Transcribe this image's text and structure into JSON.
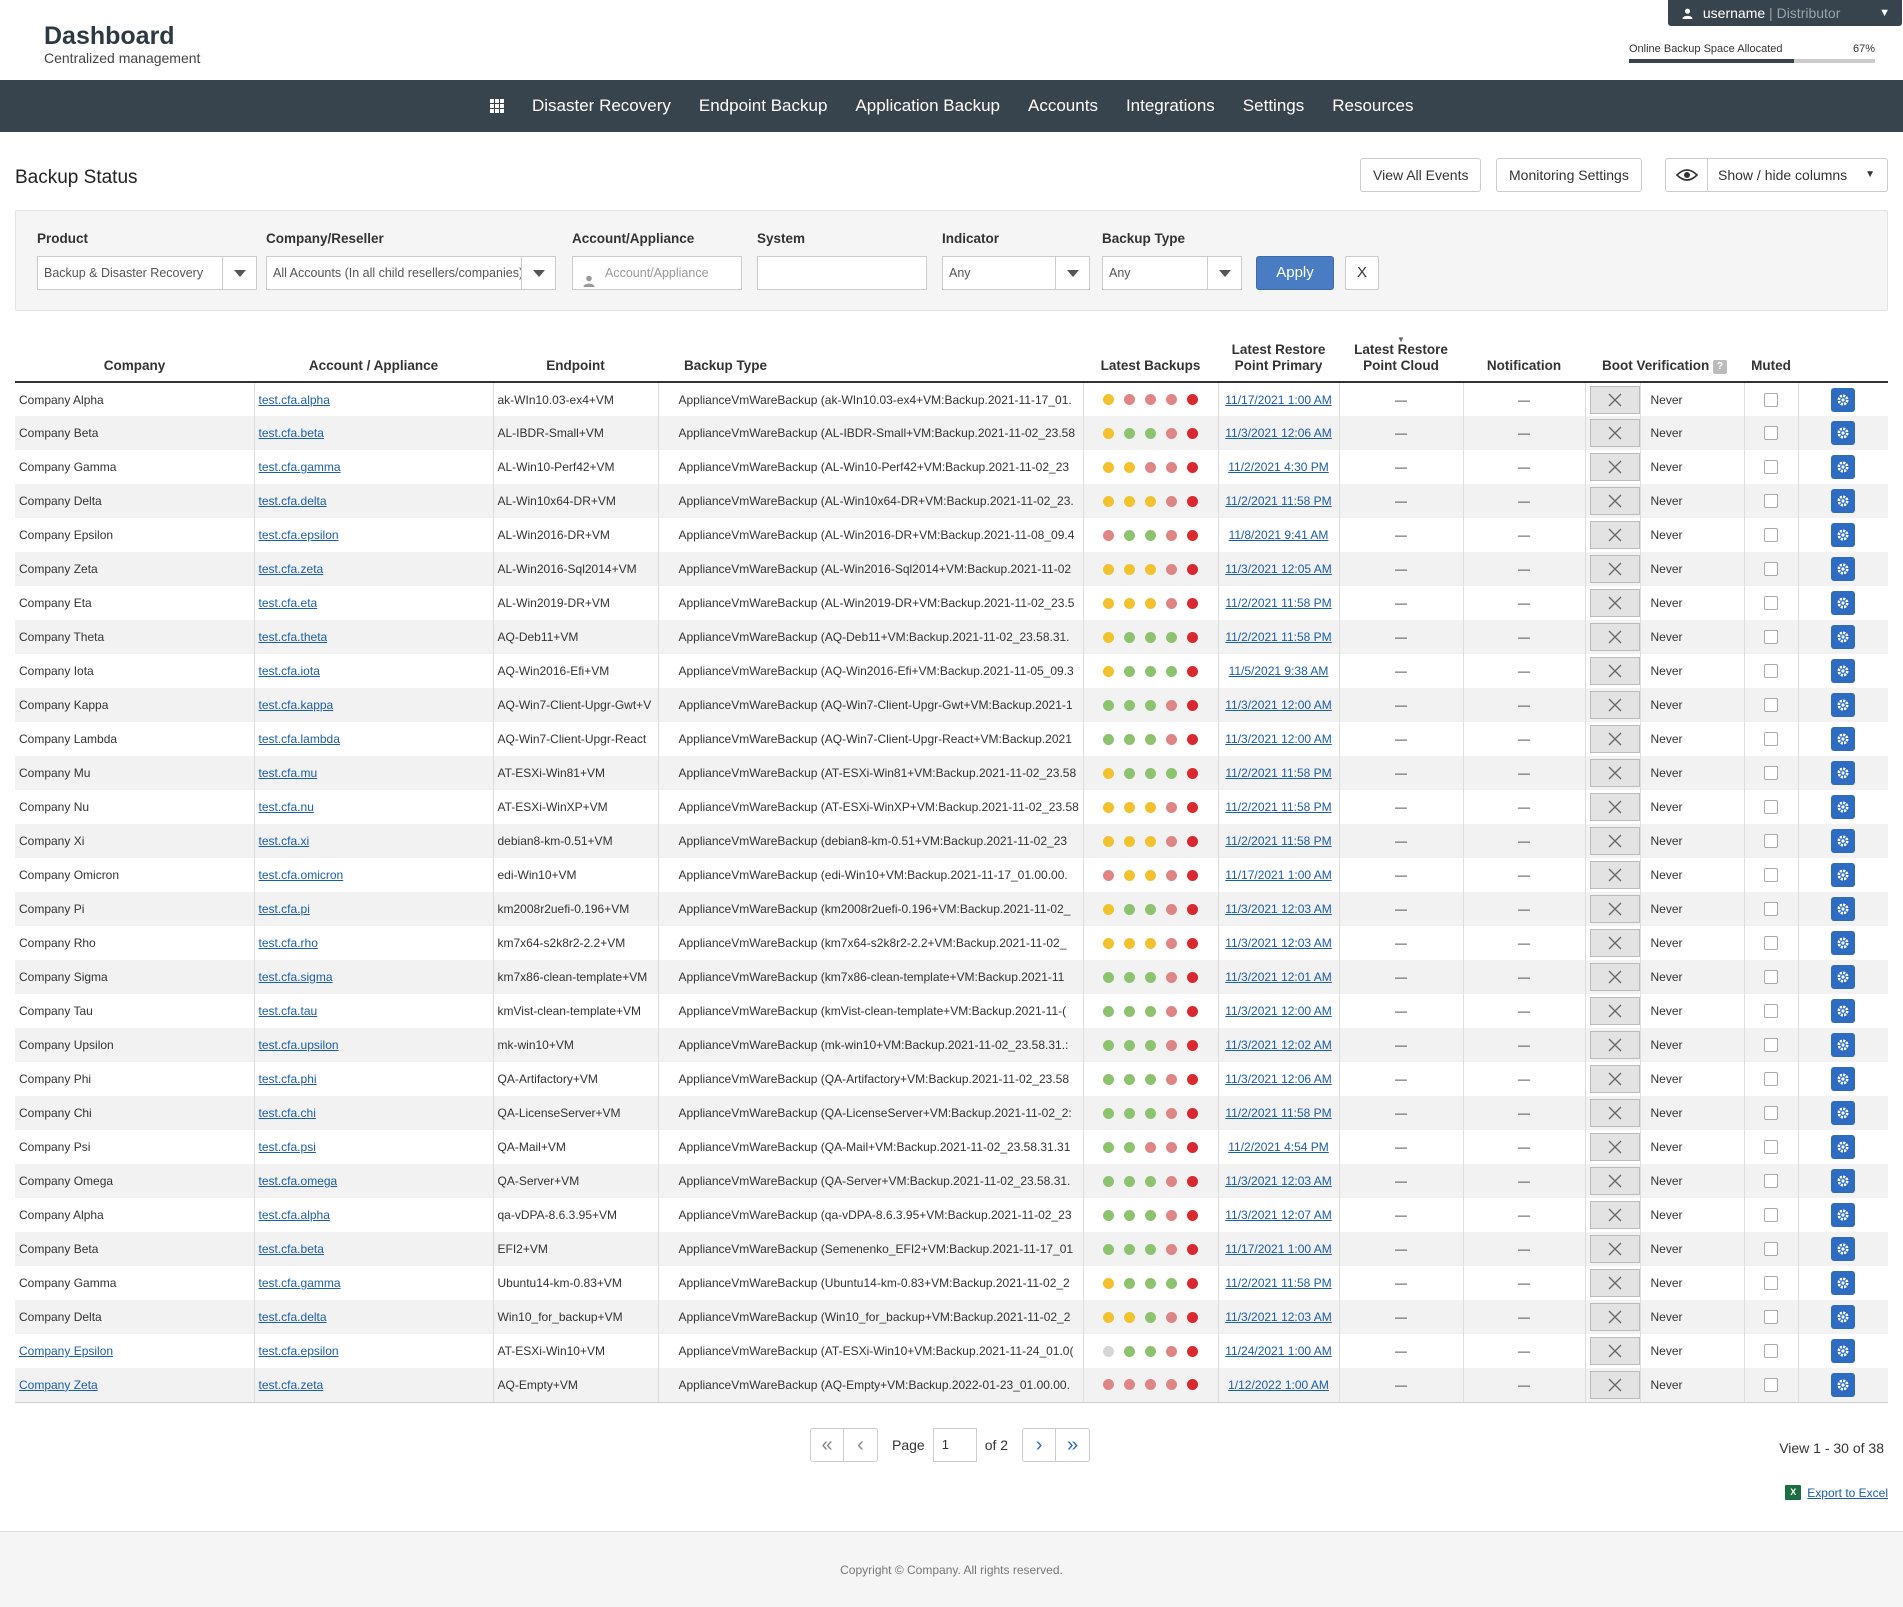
{
  "header": {
    "title": "Dashboard",
    "subtitle": "Centralized management",
    "user": {
      "name": "username",
      "role": "Distributor"
    },
    "space": {
      "label": "Online Backup Space Allocated",
      "value_text": "67%",
      "fraction": 0.67
    }
  },
  "nav": {
    "items": [
      "Disaster Recovery",
      "Endpoint Backup",
      "Application Backup",
      "Accounts",
      "Integrations",
      "Settings",
      "Resources"
    ]
  },
  "page": {
    "title": "Backup Status",
    "view_all_events": "View All Events",
    "monitoring_settings": "Monitoring Settings",
    "show_hide_columns": "Show / hide columns"
  },
  "filters": {
    "product": {
      "label": "Product",
      "value": "Backup & Disaster Recovery"
    },
    "company": {
      "label": "Company/Reseller",
      "value": "All Accounts (In all child resellers/companies)"
    },
    "account": {
      "label": "Account/Appliance",
      "placeholder": "Account/Appliance"
    },
    "system": {
      "label": "System",
      "value": ""
    },
    "indicator": {
      "label": "Indicator",
      "value": "Any"
    },
    "backup_type": {
      "label": "Backup Type",
      "value": "Any"
    },
    "apply": "Apply",
    "clear": "X"
  },
  "table": {
    "columns": {
      "company": "Company",
      "account": "Account / Appliance",
      "endpoint": "Endpoint",
      "backup_type": "Backup Type",
      "latest_backups": "Latest Backups",
      "restore_primary_1": "Latest Restore",
      "restore_primary_2": "Point Primary",
      "restore_cloud_1": "Latest Restore",
      "restore_cloud_2": "Point Cloud",
      "notification": "Notification",
      "boot_verification": "Boot Verification",
      "boot_help": "?",
      "muted": "Muted"
    },
    "dash": "—",
    "colors": {
      "y": "#f2c12e",
      "g": "#8dc26f",
      "p": "#e08585",
      "r": "#d9282f",
      "n": "#d5d5d5"
    },
    "rows": [
      {
        "company": "Company Alpha",
        "account": "test.cfa.alpha",
        "endpoint": "ak-WIn10.03-ex4+VM",
        "backup": "ApplianceVmWareBackup (ak-WIn10.03-ex4+VM:Backup.2021-11-17_01.",
        "dots": "ypppr",
        "restore": "11/17/2021 1:00 AM",
        "boot": "Never",
        "company_link": false
      },
      {
        "company": "Company Beta",
        "account": "test.cfa.beta",
        "endpoint": "AL-IBDR-Small+VM",
        "backup": "ApplianceVmWareBackup (AL-IBDR-Small+VM:Backup.2021-11-02_23.58",
        "dots": "yggpr",
        "restore": "11/3/2021 12:06 AM",
        "boot": "Never",
        "company_link": false
      },
      {
        "company": "Company Gamma",
        "account": "test.cfa.gamma",
        "endpoint": "AL-Win10-Perf42+VM",
        "backup": "ApplianceVmWareBackup (AL-Win10-Perf42+VM:Backup.2021-11-02_23",
        "dots": "yyppr",
        "restore": "11/2/2021 4:30 PM",
        "boot": "Never",
        "company_link": false
      },
      {
        "company": "Company Delta",
        "account": "test.cfa.delta",
        "endpoint": "AL-Win10x64-DR+VM",
        "backup": "ApplianceVmWareBackup (AL-Win10x64-DR+VM:Backup.2021-11-02_23.",
        "dots": "yyypr",
        "restore": "11/2/2021 11:58 PM",
        "boot": "Never",
        "company_link": false
      },
      {
        "company": "Company Epsilon",
        "account": "test.cfa.epsilon",
        "endpoint": "AL-Win2016-DR+VM",
        "backup": "ApplianceVmWareBackup (AL-Win2016-DR+VM:Backup.2021-11-08_09.4",
        "dots": "pggpr",
        "restore": "11/8/2021 9:41 AM",
        "boot": "Never",
        "company_link": false
      },
      {
        "company": "Company Zeta",
        "account": "test.cfa.zeta",
        "endpoint": "AL-Win2016-Sql2014+VM",
        "backup": "ApplianceVmWareBackup (AL-Win2016-Sql2014+VM:Backup.2021-11-02",
        "dots": "yyypr",
        "restore": "11/3/2021 12:05 AM",
        "boot": "Never",
        "company_link": false
      },
      {
        "company": "Company Eta",
        "account": "test.cfa.eta",
        "endpoint": "AL-Win2019-DR+VM",
        "backup": "ApplianceVmWareBackup (AL-Win2019-DR+VM:Backup.2021-11-02_23.5",
        "dots": "yyypr",
        "restore": "11/2/2021 11:58 PM",
        "boot": "Never",
        "company_link": false
      },
      {
        "company": "Company Theta",
        "account": "test.cfa.theta",
        "endpoint": "AQ-Deb11+VM",
        "backup": "ApplianceVmWareBackup (AQ-Deb11+VM:Backup.2021-11-02_23.58.31.",
        "dots": "ygggr",
        "restore": "11/2/2021 11:58 PM",
        "boot": "Never",
        "company_link": false
      },
      {
        "company": "Company Iota",
        "account": "test.cfa.iota",
        "endpoint": "AQ-Win2016-Efi+VM",
        "backup": "ApplianceVmWareBackup (AQ-Win2016-Efi+VM:Backup.2021-11-05_09.3",
        "dots": "ygggr",
        "restore": "11/5/2021 9:38 AM",
        "boot": "Never",
        "company_link": false
      },
      {
        "company": "Company Kappa",
        "account": "test.cfa.kappa",
        "endpoint": "AQ-Win7-Client-Upgr-Gwt+V",
        "backup": "ApplianceVmWareBackup (AQ-Win7-Client-Upgr-Gwt+VM:Backup.2021-1",
        "dots": "gggpr",
        "restore": "11/3/2021 12:00 AM",
        "boot": "Never",
        "company_link": false
      },
      {
        "company": "Company Lambda",
        "account": "test.cfa.lambda",
        "endpoint": "AQ-Win7-Client-Upgr-React",
        "backup": "ApplianceVmWareBackup (AQ-Win7-Client-Upgr-React+VM:Backup.2021",
        "dots": "gggpr",
        "restore": "11/3/2021 12:00 AM",
        "boot": "Never",
        "company_link": false
      },
      {
        "company": "Company Mu",
        "account": "test.cfa.mu",
        "endpoint": "AT-ESXi-Win81+VM",
        "backup": "ApplianceVmWareBackup (AT-ESXi-Win81+VM:Backup.2021-11-02_23.58",
        "dots": "ygggr",
        "restore": "11/2/2021 11:58 PM",
        "boot": "Never",
        "company_link": false
      },
      {
        "company": "Company Nu",
        "account": "test.cfa.nu",
        "endpoint": "AT-ESXi-WinXP+VM",
        "backup": "ApplianceVmWareBackup (AT-ESXi-WinXP+VM:Backup.2021-11-02_23.58",
        "dots": "yyypr",
        "restore": "11/2/2021 11:58 PM",
        "boot": "Never",
        "company_link": false
      },
      {
        "company": "Company Xi",
        "account": "test.cfa.xi",
        "endpoint": "debian8-km-0.51+VM",
        "backup": "ApplianceVmWareBackup (debian8-km-0.51+VM:Backup.2021-11-02_23",
        "dots": "yyypr",
        "restore": "11/2/2021 11:58 PM",
        "boot": "Never",
        "company_link": false
      },
      {
        "company": "Company Omicron",
        "account": "test.cfa.omicron",
        "endpoint": "edi-Win10+VM",
        "backup": "ApplianceVmWareBackup (edi-Win10+VM:Backup.2021-11-17_01.00.00.",
        "dots": "pyypr",
        "restore": "11/17/2021 1:00 AM",
        "boot": "Never",
        "company_link": false
      },
      {
        "company": "Company Pi",
        "account": "test.cfa.pi",
        "endpoint": "km2008r2uefi-0.196+VM",
        "backup": "ApplianceVmWareBackup (km2008r2uefi-0.196+VM:Backup.2021-11-02_",
        "dots": "yggpr",
        "restore": "11/3/2021 12:03 AM",
        "boot": "Never",
        "company_link": false
      },
      {
        "company": "Company Rho",
        "account": "test.cfa.rho",
        "endpoint": "km7x64-s2k8r2-2.2+VM",
        "backup": "ApplianceVmWareBackup (km7x64-s2k8r2-2.2+VM:Backup.2021-11-02_",
        "dots": "yyypr",
        "restore": "11/3/2021 12:03 AM",
        "boot": "Never",
        "company_link": false
      },
      {
        "company": "Company Sigma",
        "account": "test.cfa.sigma",
        "endpoint": "km7x86-clean-template+VM",
        "backup": "ApplianceVmWareBackup (km7x86-clean-template+VM:Backup.2021-11",
        "dots": "gggpr",
        "restore": "11/3/2021 12:01 AM",
        "boot": "Never",
        "company_link": false
      },
      {
        "company": "Company Tau",
        "account": "test.cfa.tau",
        "endpoint": "kmVist-clean-template+VM",
        "backup": "ApplianceVmWareBackup (kmVist-clean-template+VM:Backup.2021-11-(",
        "dots": "gggpr",
        "restore": "11/3/2021 12:00 AM",
        "boot": "Never",
        "company_link": false
      },
      {
        "company": "Company Upsilon",
        "account": "test.cfa.upsilon",
        "endpoint": "mk-win10+VM",
        "backup": "ApplianceVmWareBackup (mk-win10+VM:Backup.2021-11-02_23.58.31.:",
        "dots": "gggpr",
        "restore": "11/3/2021 12:02 AM",
        "boot": "Never",
        "company_link": false
      },
      {
        "company": "Company Phi",
        "account": "test.cfa.phi",
        "endpoint": "QA-Artifactory+VM",
        "backup": "ApplianceVmWareBackup (QA-Artifactory+VM:Backup.2021-11-02_23.58",
        "dots": "gggpr",
        "restore": "11/3/2021 12:06 AM",
        "boot": "Never",
        "company_link": false
      },
      {
        "company": "Company Chi",
        "account": "test.cfa.chi",
        "endpoint": "QA-LicenseServer+VM",
        "backup": "ApplianceVmWareBackup (QA-LicenseServer+VM:Backup.2021-11-02_2:",
        "dots": "gggpr",
        "restore": "11/2/2021 11:58 PM",
        "boot": "Never",
        "company_link": false
      },
      {
        "company": "Company Psi",
        "account": "test.cfa.psi",
        "endpoint": "QA-Mail+VM",
        "backup": "ApplianceVmWareBackup (QA-Mail+VM:Backup.2021-11-02_23.58.31.31",
        "dots": "ggppr",
        "restore": "11/2/2021 4:54 PM",
        "boot": "Never",
        "company_link": false
      },
      {
        "company": "Company Omega",
        "account": "test.cfa.omega",
        "endpoint": "QA-Server+VM",
        "backup": "ApplianceVmWareBackup (QA-Server+VM:Backup.2021-11-02_23.58.31.",
        "dots": "gggpr",
        "restore": "11/3/2021 12:03 AM",
        "boot": "Never",
        "company_link": false
      },
      {
        "company": "Company Alpha",
        "account": "test.cfa.alpha",
        "endpoint": "qa-vDPA-8.6.3.95+VM",
        "backup": "ApplianceVmWareBackup (qa-vDPA-8.6.3.95+VM:Backup.2021-11-02_23",
        "dots": "gggpr",
        "restore": "11/3/2021 12:07 AM",
        "boot": "Never",
        "company_link": false
      },
      {
        "company": "Company Beta",
        "account": "test.cfa.beta",
        "endpoint": "EFI2+VM",
        "backup": "ApplianceVmWareBackup (Semenenko_EFI2+VM:Backup.2021-11-17_01",
        "dots": "gggpr",
        "restore": "11/17/2021 1:00 AM",
        "boot": "Never",
        "company_link": false
      },
      {
        "company": "Company Gamma",
        "account": "test.cfa.gamma",
        "endpoint": "Ubuntu14-km-0.83+VM",
        "backup": "ApplianceVmWareBackup (Ubuntu14-km-0.83+VM:Backup.2021-11-02_2",
        "dots": "ygggr",
        "restore": "11/2/2021 11:58 PM",
        "boot": "Never",
        "company_link": false
      },
      {
        "company": "Company Delta",
        "account": "test.cfa.delta",
        "endpoint": "Win10_for_backup+VM",
        "backup": "ApplianceVmWareBackup (Win10_for_backup+VM:Backup.2021-11-02_2",
        "dots": "yygpr",
        "restore": "11/3/2021 12:03 AM",
        "boot": "Never",
        "company_link": false
      },
      {
        "company": "Company Epsilon",
        "account": "test.cfa.epsilon",
        "endpoint": "AT-ESXi-Win10+VM",
        "backup": "ApplianceVmWareBackup (AT-ESXi-Win10+VM:Backup.2021-11-24_01.0(",
        "dots": "nggpr",
        "restore": "11/24/2021 1:00 AM",
        "boot": "Never",
        "company_link": true
      },
      {
        "company": "Company Zeta",
        "account": "test.cfa.zeta",
        "endpoint": "AQ-Empty+VM",
        "backup": "ApplianceVmWareBackup (AQ-Empty+VM:Backup.2022-01-23_01.00.00.",
        "dots": "ppppr",
        "restore": "1/12/2022 1:00 AM",
        "boot": "Never",
        "company_link": true
      }
    ]
  },
  "pager": {
    "page_label": "Page",
    "page_value": "1",
    "of_label": "of 2",
    "view_count": "View 1 - 30 of 38",
    "export": "Export to Excel",
    "export_icon_text": "X"
  },
  "footer": {
    "copyright": "Copyright © Company. All rights reserved."
  }
}
